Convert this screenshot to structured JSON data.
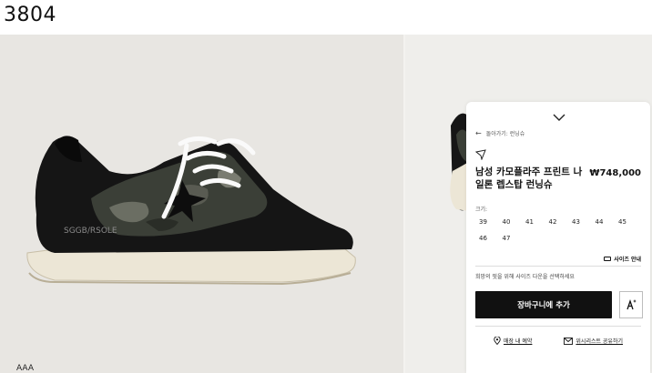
{
  "page_id": "3804",
  "product": {
    "back_link": "돌아가기: 런닝슈",
    "title": "남성 카모플라주 프린트 나일론 렙스탑 런닝슈",
    "price": "₩748,000",
    "size_label": "크기:",
    "sizes": [
      "39",
      "40",
      "41",
      "42",
      "43",
      "44",
      "45",
      "46",
      "47"
    ],
    "size_guide": "사이즈 안내",
    "size_notice": "희망의 핏을 위해 사이즈 다운을 선택하세요",
    "add_to_cart": "장바구니에 추가",
    "store_reserve": "매장 내 예약",
    "wishlist_share": "위시리스트 공유하기"
  },
  "image": {
    "shoe_brand_print": "SGGB/RSOLE"
  },
  "footer_partial": "AAA"
}
